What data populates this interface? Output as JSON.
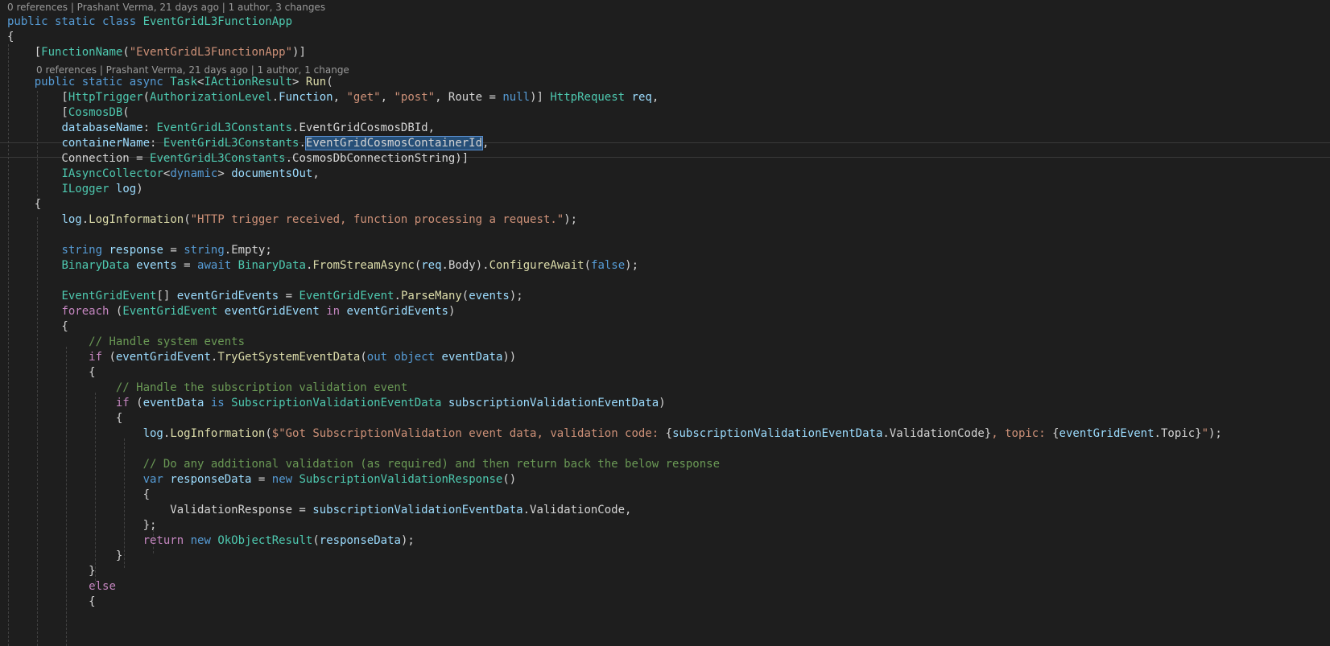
{
  "codelens": {
    "class_lens": "0 references | Prashant Verma, 21 days ago | 1 author, 3 changes",
    "method_lens": "0 references | Prashant Verma, 21 days ago | 1 author, 1 change"
  },
  "lines": [
    [
      [
        "kw",
        "public static class "
      ],
      [
        "ty",
        "EventGridL3FunctionApp"
      ]
    ],
    [
      [
        "pl",
        "{"
      ]
    ],
    [
      [
        "pl",
        "    ["
      ],
      [
        "ty",
        "FunctionName"
      ],
      [
        "pl",
        "("
      ],
      [
        "st",
        "\"EventGridL3FunctionApp\""
      ],
      [
        "pl",
        ")]"
      ]
    ],
    [
      [
        "pl",
        "    "
      ],
      [
        "kw",
        "public static async "
      ],
      [
        "ty",
        "Task"
      ],
      [
        "pl",
        "<"
      ],
      [
        "ty",
        "IActionResult"
      ],
      [
        "pl",
        "> "
      ],
      [
        "fn",
        "Run"
      ],
      [
        "pl",
        "("
      ]
    ],
    [
      [
        "pl",
        "        ["
      ],
      [
        "ty",
        "HttpTrigger"
      ],
      [
        "pl",
        "("
      ],
      [
        "ty",
        "AuthorizationLevel"
      ],
      [
        "pl",
        "."
      ],
      [
        "vr",
        "Function"
      ],
      [
        "pl",
        ", "
      ],
      [
        "st",
        "\"get\""
      ],
      [
        "pl",
        ", "
      ],
      [
        "st",
        "\"post\""
      ],
      [
        "pl",
        ", Route = "
      ],
      [
        "kw",
        "null"
      ],
      [
        "pl",
        ")] "
      ],
      [
        "ty",
        "HttpRequest"
      ],
      [
        "pl",
        " "
      ],
      [
        "vr",
        "req"
      ],
      [
        "pl",
        ","
      ]
    ],
    [
      [
        "pl",
        "        ["
      ],
      [
        "ty",
        "CosmosDB"
      ],
      [
        "pl",
        "("
      ]
    ],
    [
      [
        "pl",
        "        "
      ],
      [
        "vr",
        "databaseName"
      ],
      [
        "pl",
        ": "
      ],
      [
        "ty",
        "EventGridL3Constants"
      ],
      [
        "pl",
        ".EventGridCosmosDBId,"
      ]
    ],
    [
      [
        "pl",
        "        "
      ],
      [
        "vr",
        "containerName"
      ],
      [
        "pl",
        ": "
      ],
      [
        "ty",
        "EventGridL3Constants"
      ],
      [
        "pl",
        "."
      ],
      [
        "sel",
        "EventGridCosmosContainerId"
      ],
      [
        "pl",
        ","
      ]
    ],
    [
      [
        "pl",
        "        Connection = "
      ],
      [
        "ty",
        "EventGridL3Constants"
      ],
      [
        "pl",
        ".CosmosDbConnectionString)]"
      ]
    ],
    [
      [
        "pl",
        "        "
      ],
      [
        "ty",
        "IAsyncCollector"
      ],
      [
        "pl",
        "<"
      ],
      [
        "kw",
        "dynamic"
      ],
      [
        "pl",
        "> "
      ],
      [
        "vr",
        "documentsOut"
      ],
      [
        "pl",
        ","
      ]
    ],
    [
      [
        "pl",
        "        "
      ],
      [
        "ty",
        "ILogger"
      ],
      [
        "pl",
        " "
      ],
      [
        "vr",
        "log"
      ],
      [
        "pl",
        ")"
      ]
    ],
    [
      [
        "pl",
        "    {"
      ]
    ],
    [
      [
        "pl",
        "        "
      ],
      [
        "vr",
        "log"
      ],
      [
        "pl",
        "."
      ],
      [
        "fn",
        "LogInformation"
      ],
      [
        "pl",
        "("
      ],
      [
        "st",
        "\"HTTP trigger received, function processing a request.\""
      ],
      [
        "pl",
        ");"
      ]
    ],
    [],
    [
      [
        "pl",
        "        "
      ],
      [
        "kw",
        "string"
      ],
      [
        "pl",
        " "
      ],
      [
        "vr",
        "response"
      ],
      [
        "pl",
        " = "
      ],
      [
        "kw",
        "string"
      ],
      [
        "pl",
        ".Empty;"
      ]
    ],
    [
      [
        "pl",
        "        "
      ],
      [
        "ty",
        "BinaryData"
      ],
      [
        "pl",
        " "
      ],
      [
        "vr",
        "events"
      ],
      [
        "pl",
        " = "
      ],
      [
        "kw",
        "await"
      ],
      [
        "pl",
        " "
      ],
      [
        "ty",
        "BinaryData"
      ],
      [
        "pl",
        "."
      ],
      [
        "fn",
        "FromStreamAsync"
      ],
      [
        "pl",
        "("
      ],
      [
        "vr",
        "req"
      ],
      [
        "pl",
        ".Body)."
      ],
      [
        "fn",
        "ConfigureAwait"
      ],
      [
        "pl",
        "("
      ],
      [
        "kw",
        "false"
      ],
      [
        "pl",
        ");"
      ]
    ],
    [],
    [
      [
        "pl",
        "        "
      ],
      [
        "ty",
        "EventGridEvent"
      ],
      [
        "pl",
        "[] "
      ],
      [
        "vr",
        "eventGridEvents"
      ],
      [
        "pl",
        " = "
      ],
      [
        "ty",
        "EventGridEvent"
      ],
      [
        "pl",
        "."
      ],
      [
        "fn",
        "ParseMany"
      ],
      [
        "pl",
        "("
      ],
      [
        "vr",
        "events"
      ],
      [
        "pl",
        ");"
      ]
    ],
    [
      [
        "pl",
        "        "
      ],
      [
        "ctl",
        "foreach"
      ],
      [
        "pl",
        " ("
      ],
      [
        "ty",
        "EventGridEvent"
      ],
      [
        "pl",
        " "
      ],
      [
        "vr",
        "eventGridEvent"
      ],
      [
        "pl",
        " "
      ],
      [
        "ctl",
        "in"
      ],
      [
        "pl",
        " "
      ],
      [
        "vr",
        "eventGridEvents"
      ],
      [
        "pl",
        ")"
      ]
    ],
    [
      [
        "pl",
        "        {"
      ]
    ],
    [
      [
        "pl",
        "            "
      ],
      [
        "cm",
        "// Handle system events"
      ]
    ],
    [
      [
        "pl",
        "            "
      ],
      [
        "ctl",
        "if"
      ],
      [
        "pl",
        " ("
      ],
      [
        "vr",
        "eventGridEvent"
      ],
      [
        "pl",
        "."
      ],
      [
        "fn",
        "TryGetSystemEventData"
      ],
      [
        "pl",
        "("
      ],
      [
        "kw",
        "out object"
      ],
      [
        "pl",
        " "
      ],
      [
        "vr",
        "eventData"
      ],
      [
        "pl",
        "))"
      ]
    ],
    [
      [
        "pl",
        "            {"
      ]
    ],
    [
      [
        "pl",
        "                "
      ],
      [
        "cm",
        "// Handle the subscription validation event"
      ]
    ],
    [
      [
        "pl",
        "                "
      ],
      [
        "ctl",
        "if"
      ],
      [
        "pl",
        " ("
      ],
      [
        "vr",
        "eventData"
      ],
      [
        "pl",
        " "
      ],
      [
        "kw",
        "is"
      ],
      [
        "pl",
        " "
      ],
      [
        "ty",
        "SubscriptionValidationEventData"
      ],
      [
        "pl",
        " "
      ],
      [
        "vr",
        "subscriptionValidationEventData"
      ],
      [
        "pl",
        ")"
      ]
    ],
    [
      [
        "pl",
        "                {"
      ]
    ],
    [
      [
        "pl",
        "                    "
      ],
      [
        "vr",
        "log"
      ],
      [
        "pl",
        "."
      ],
      [
        "fn",
        "LogInformation"
      ],
      [
        "pl",
        "("
      ],
      [
        "st",
        "$\"Got SubscriptionValidation event data, validation code: "
      ],
      [
        "pl",
        "{"
      ],
      [
        "vr",
        "subscriptionValidationEventData"
      ],
      [
        "pl",
        ".ValidationCode}"
      ],
      [
        "st",
        ", topic: "
      ],
      [
        "pl",
        "{"
      ],
      [
        "vr",
        "eventGridEvent"
      ],
      [
        "pl",
        ".Topic}"
      ],
      [
        "st",
        "\""
      ],
      [
        "pl",
        ");"
      ]
    ],
    [],
    [
      [
        "pl",
        "                    "
      ],
      [
        "cm",
        "// Do any additional validation (as required) and then return back the below response"
      ]
    ],
    [
      [
        "pl",
        "                    "
      ],
      [
        "kw",
        "var"
      ],
      [
        "pl",
        " "
      ],
      [
        "vr",
        "responseData"
      ],
      [
        "pl",
        " = "
      ],
      [
        "kw",
        "new"
      ],
      [
        "pl",
        " "
      ],
      [
        "ty",
        "SubscriptionValidationResponse"
      ],
      [
        "pl",
        "()"
      ]
    ],
    [
      [
        "pl",
        "                    {"
      ]
    ],
    [
      [
        "pl",
        "                        ValidationResponse = "
      ],
      [
        "vr",
        "subscriptionValidationEventData"
      ],
      [
        "pl",
        ".ValidationCode,"
      ]
    ],
    [
      [
        "pl",
        "                    };"
      ]
    ],
    [
      [
        "pl",
        "                    "
      ],
      [
        "ctl",
        "return"
      ],
      [
        "pl",
        " "
      ],
      [
        "kw",
        "new"
      ],
      [
        "pl",
        " "
      ],
      [
        "ty",
        "OkObjectResult"
      ],
      [
        "pl",
        "("
      ],
      [
        "vr",
        "responseData"
      ],
      [
        "pl",
        ");"
      ]
    ],
    [
      [
        "pl",
        "                }"
      ]
    ],
    [
      [
        "pl",
        "            }"
      ]
    ],
    [
      [
        "pl",
        "            "
      ],
      [
        "ctl",
        "else"
      ]
    ],
    [
      [
        "pl",
        "            {"
      ]
    ]
  ]
}
